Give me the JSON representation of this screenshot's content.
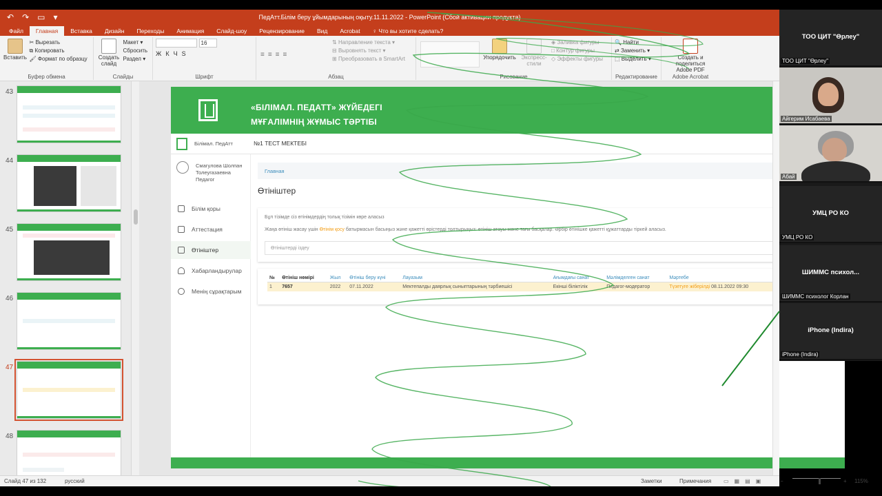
{
  "window": {
    "title": "ПедАтт.Білім беру ұйымдарының оқыту.11.11.2022 - PowerPoint (Сбой активации продукта)"
  },
  "ribbon_tabs": [
    "Файл",
    "Главная",
    "Вставка",
    "Дизайн",
    "Переходы",
    "Анимация",
    "Слайд-шоу",
    "Рецензирование",
    "Вид",
    "Acrobat"
  ],
  "tell_me": "Что вы хотите сделать?",
  "ribbon": {
    "clipboard": {
      "paste": "Вставить",
      "cut": "Вырезать",
      "copy": "Копировать",
      "format_painter": "Формат по образцу",
      "label": "Буфер обмена"
    },
    "slides": {
      "new_slide": "Создать слайд",
      "layout": "Макет",
      "reset": "Сбросить",
      "section": "Раздел",
      "label": "Слайды"
    },
    "font": {
      "size": "16",
      "label": "Шрифт",
      "bold": "Ж",
      "italic": "К",
      "underline": "Ч",
      "strike": "S"
    },
    "paragraph": {
      "text_direction": "Направление текста",
      "align_text": "Выровнять текст",
      "smartart": "Преобразовать в SmartArt",
      "label": "Абзац"
    },
    "drawing": {
      "arrange": "Упорядочить",
      "quick_styles": "Экспресс-стили",
      "fill": "Заливка фигуры",
      "outline": "Контур фигуры",
      "effects": "Эффекты фигуры",
      "label": "Рисование"
    },
    "editing": {
      "find": "Найти",
      "replace": "Заменить",
      "select": "Выделить",
      "label": "Редактирование"
    },
    "acrobat": {
      "create": "Создать и поделиться",
      "pdf": "Adobe PDF",
      "label": "Adobe Acrobat"
    }
  },
  "thumbnails": [
    {
      "num": "43"
    },
    {
      "num": "44"
    },
    {
      "num": "45"
    },
    {
      "num": "46"
    },
    {
      "num": "47"
    },
    {
      "num": "48"
    }
  ],
  "slide": {
    "title_line1": "«БІЛІМАЛ. ПЕДАТТ» ЖҮЙЕДЕГІ",
    "title_line2": "МҰҒАЛІМНІҢ ЖҰМЫС ТӘРТІБІ",
    "brand_letter": "с",
    "site_name": "Білімал. ПедАтт",
    "school": "№1 ТЕСТ МЕКТЕБІ",
    "help": "?",
    "trail": "R",
    "user": "Смагулова Шолпан Толеугазаевна Педагог",
    "menu": [
      "Білім қоры",
      "Аттестация",
      "Өтініштер",
      "Хабарландырулар",
      "Менің сұрақтарым"
    ],
    "breadcrumb": "Главная",
    "page_heading": "Өтініштер",
    "info1": "Бұл тізімде сіз өтінімдердің толық тізімін көре аласыз",
    "info2_pre": "Жаңа өтініш жасау үшін ",
    "info2_link": "Өтінім қосу",
    "info2_post": " батырмасын басыңыз және қажетті өрістерді толтырыңыз: өтініш атауы және тағы басқалар. Әрбір өтінішке қажетті құжаттарды тіркей аласыз.",
    "search_placeholder": "Өтініштерді іздеу",
    "table": {
      "headers": [
        "№",
        "Өтініш нөмірі",
        "Жыл",
        "Өтініш беру күні",
        "Лауазым",
        "Ағымдағы санат",
        "Мәлімделген санат",
        "Мәртебе"
      ],
      "rows": [
        {
          "num": "1",
          "app_no": "7657",
          "year": "2022",
          "date": "07.11.2022",
          "position": "Мектепалды даярлық сыныптарының тәрбиешісі",
          "current": "Екінші біліктілік",
          "declared": "Педагог-модератор",
          "status": "Түзетуге жіберілді",
          "status_date": "08.11.2022 09:30"
        }
      ]
    }
  },
  "statusbar": {
    "slide_info": "Слайд 47 из 132",
    "language": "русский",
    "notes": "Заметки",
    "comments": "Примечания",
    "zoom": "115%"
  },
  "participants": [
    {
      "big": "ТОО ЦИТ \"Өрлеу\"",
      "small": "ТОО ЦИТ \"Өрлеу\""
    },
    {
      "big": "",
      "small": "Айгерим Исабаева"
    },
    {
      "big": "",
      "small": "Абай"
    },
    {
      "big": "УМЦ РО КО",
      "small": "УМЦ РО КО"
    },
    {
      "big": "ШИММС психол...",
      "small": "ШИММС психолог Корлан"
    },
    {
      "big": "iPhone (Indira)",
      "small": "iPhone (Indira)"
    }
  ],
  "colors": {
    "ppt_accent": "#c43e1c",
    "slide_green": "#3dae4f",
    "link_blue": "#3c8dbc",
    "status_orange": "#f39c12"
  }
}
